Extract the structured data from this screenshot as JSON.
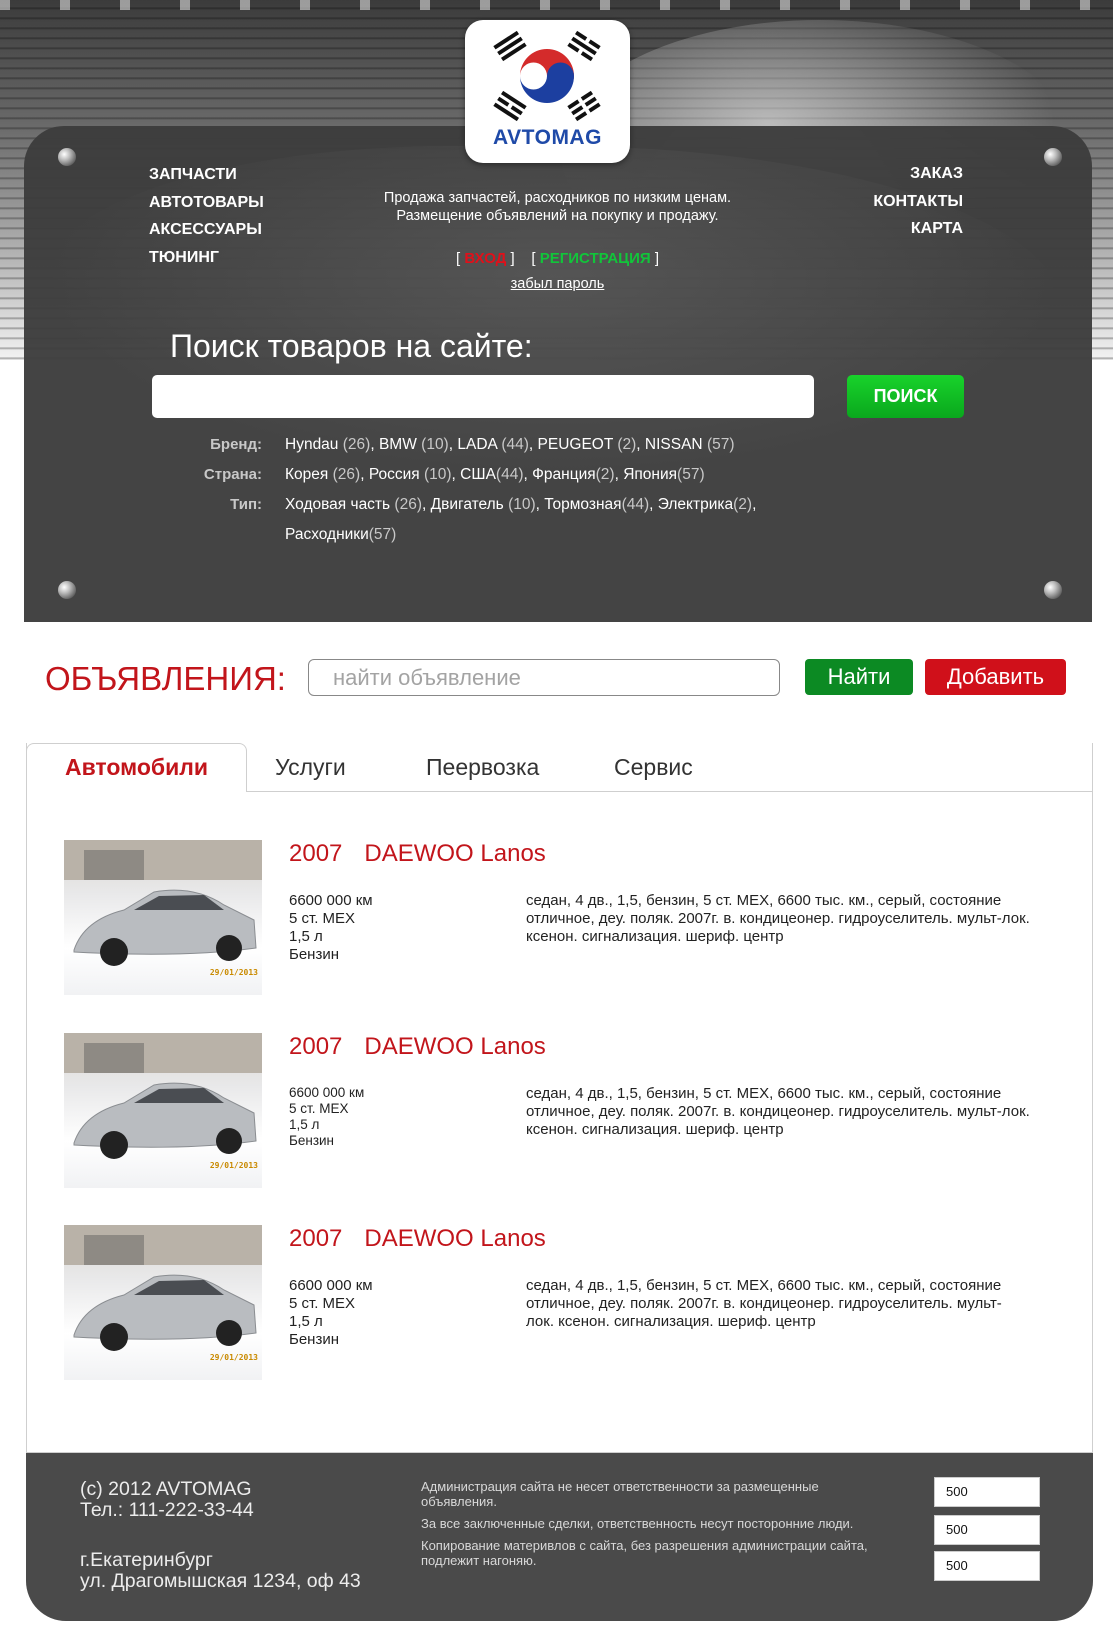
{
  "brand": {
    "logo_text": "AVTOMAG"
  },
  "header": {
    "nav_left": [
      "ЗАПЧАСТИ",
      "АВТОТОВАРЫ",
      "АКСЕССУАРЫ",
      "ТЮНИНГ"
    ],
    "nav_right": [
      "ЗАКАЗ",
      "КОНТАКТЫ",
      "КАРТА"
    ],
    "tagline_line1": "Продажа запчастей, расходников по низким ценам.",
    "tagline_line2": "Размещение объявлений на покупку и продажу.",
    "login_label": "ВХОД",
    "register_label": "РЕГИСТРАЦИЯ",
    "forgot_label": "забыл пароль"
  },
  "site_search": {
    "title": "Поиск товаров на сайте:",
    "value": "",
    "button_label": "ПОИСК"
  },
  "filters": [
    {
      "label": "Бренд:",
      "items": [
        {
          "name": "Hyndau",
          "count": "(26)"
        },
        {
          "name": "BMW",
          "count": "(10)"
        },
        {
          "name": "LADA",
          "count": "(44)"
        },
        {
          "name": "PEUGEOT",
          "count": "(2)"
        },
        {
          "name": "NISSAN",
          "count": "(57)"
        }
      ]
    },
    {
      "label": "Страна:",
      "items": [
        {
          "name": "Корея",
          "count": "(26)"
        },
        {
          "name": "Россия",
          "count": "(10)"
        },
        {
          "name": "США",
          "count": "(44)"
        },
        {
          "name": "Франция",
          "count": "(2)"
        },
        {
          "name": "Япония",
          "count": "(57)"
        }
      ]
    },
    {
      "label": "Тип:",
      "items": [
        {
          "name": "Ходовая часть",
          "count": "(26)"
        },
        {
          "name": "Двигатель",
          "count": "(10)"
        },
        {
          "name": "Тормозная",
          "count": "(44)"
        },
        {
          "name": "Электрика",
          "count": "(2)"
        },
        {
          "name": "Расходники",
          "count": "(57)"
        }
      ]
    }
  ],
  "ads": {
    "title": "ОБЪЯВЛЕНИЯ:",
    "search_placeholder": "найти объявление",
    "find_label": "Найти",
    "add_label": "Добавить"
  },
  "tabs": [
    "Автомобили",
    "Услуги",
    "Пеервозка",
    "Сервис"
  ],
  "listings": [
    {
      "year": "2007",
      "model": "DAEWOO Lanos",
      "specs": [
        "6600 000 км",
        "5 ст. МЕХ",
        "1,5 л",
        "Бензин"
      ],
      "desc_lines": [
        "седан, 4 дв., 1,5, бензин, 5 ст. МЕХ, 6600 тыс. км., серый, состояние",
        "отличное, деу. поляк. 2007г. в. кондицеонер. гидроуселитель. мульт-лок.",
        "ксенон. сигнализация. шериф. центр"
      ],
      "stamp": "29/01/2013"
    },
    {
      "year": "2007",
      "model": "DAEWOO Lanos",
      "specs": [
        "6600 000 км",
        "5 ст. МЕХ",
        "1,5 л",
        "Бензин"
      ],
      "desc_lines": [
        "седан, 4 дв., 1,5, бензин, 5 ст. МЕХ, 6600 тыс. км., серый, состояние",
        "отличное, деу. поляк. 2007г. в. кондицеонер. гидроуселитель. мульт-лок.",
        "ксенон. сигнализация. шериф. центр"
      ],
      "stamp": "29/01/2013"
    },
    {
      "year": "2007",
      "model": "DAEWOO Lanos",
      "specs": [
        "6600 000 км",
        "5 ст. МЕХ",
        "1,5 л",
        "Бензин"
      ],
      "desc_lines": [
        "седан, 4 дв., 1,5, бензин, 5 ст. МЕХ, 6600 тыс. км., серый, состояние",
        "отличное, деу. поляк. 2007г. в. кондицеонер. гидроуселитель. мульт-",
        "лок. ксенон. сигнализация. шериф. центр"
      ],
      "stamp": "29/01/2013"
    }
  ],
  "footer": {
    "copyright": "(c) 2012 AVTOMAG",
    "phone": "Тел.: 111-222-33-44",
    "city": "г.Екатеринбург",
    "street": "ул. Драгомышская 1234, оф 43",
    "disclaimer": [
      "Администрация сайта не несет ответственности за размещенные объявления.",
      "За все заключенные сделки, ответственность несут посторонние люди.",
      "Копирование материвлов с сайта, без разрешения администрации сайта, подлежит нагоняю."
    ],
    "boxes": [
      "500",
      "500",
      "500"
    ]
  },
  "colors": {
    "accent_red": "#c2151b",
    "green": "#0c8a23",
    "panel": "#3c3c3c",
    "logo_blue": "#1f4aa8"
  }
}
